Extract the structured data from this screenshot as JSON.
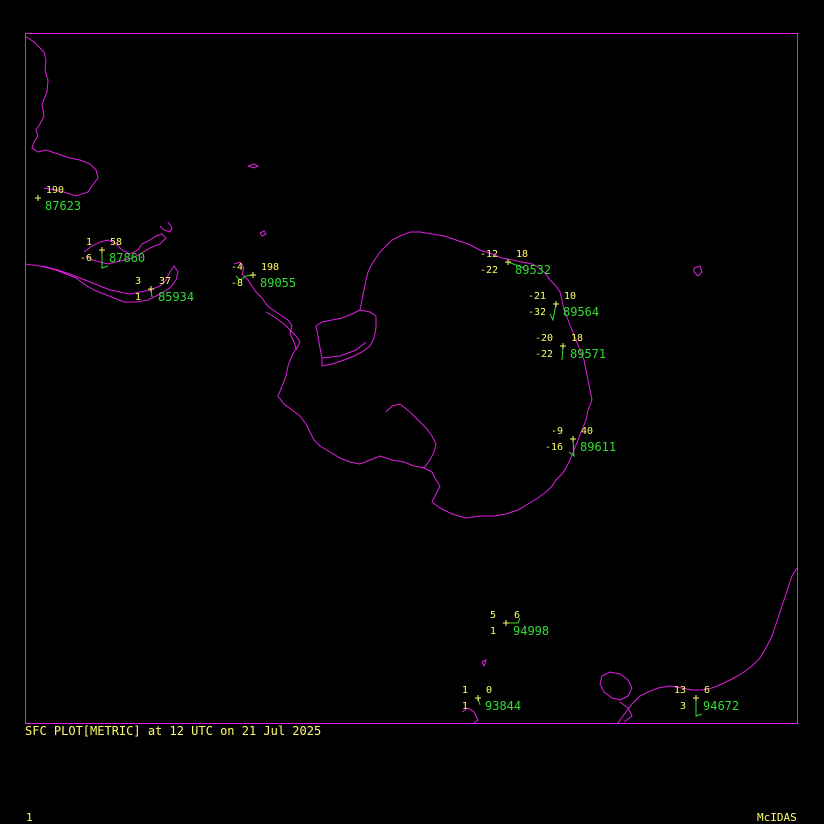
{
  "colors": {
    "background": "#000000",
    "coast": "#e020e0",
    "frame": "#e020e0",
    "value": "#ffff66",
    "station_id": "#33dd33",
    "wind": "#33dd33",
    "caption": "#ffff66"
  },
  "caption": "SFC PLOT[METRIC] at 12 UTC on 21 Jul 2025",
  "frame_number": "1",
  "brand": "McIDAS",
  "stations": [
    {
      "id": "87623",
      "top_right": "190"
    },
    {
      "id": "87860",
      "top_left": "1",
      "top_right": "58",
      "left": "-6"
    },
    {
      "id": "85934",
      "top_left": "3",
      "top_right": "37",
      "left": "1"
    },
    {
      "id": "89055",
      "top_left": "-4",
      "top_right": "198",
      "left": "-8"
    },
    {
      "id": "89532",
      "top_left": "-12",
      "top_right": "18",
      "left": "-22"
    },
    {
      "id": "89564",
      "top_left": "-21",
      "top_right": "10",
      "left": "-32"
    },
    {
      "id": "89571",
      "top_left": "-20",
      "top_right": "18",
      "left": "-22"
    },
    {
      "id": "89611",
      "top_left": "-9",
      "top_right": "40",
      "left": "-16"
    },
    {
      "id": "94998",
      "top_left": "5",
      "top_right": "6",
      "left": "1"
    },
    {
      "id": "93844",
      "top_left": "1",
      "top_right": "0",
      "left": "1"
    },
    {
      "id": "94672",
      "top_left": "13",
      "top_right": "6",
      "left": "3"
    }
  ]
}
